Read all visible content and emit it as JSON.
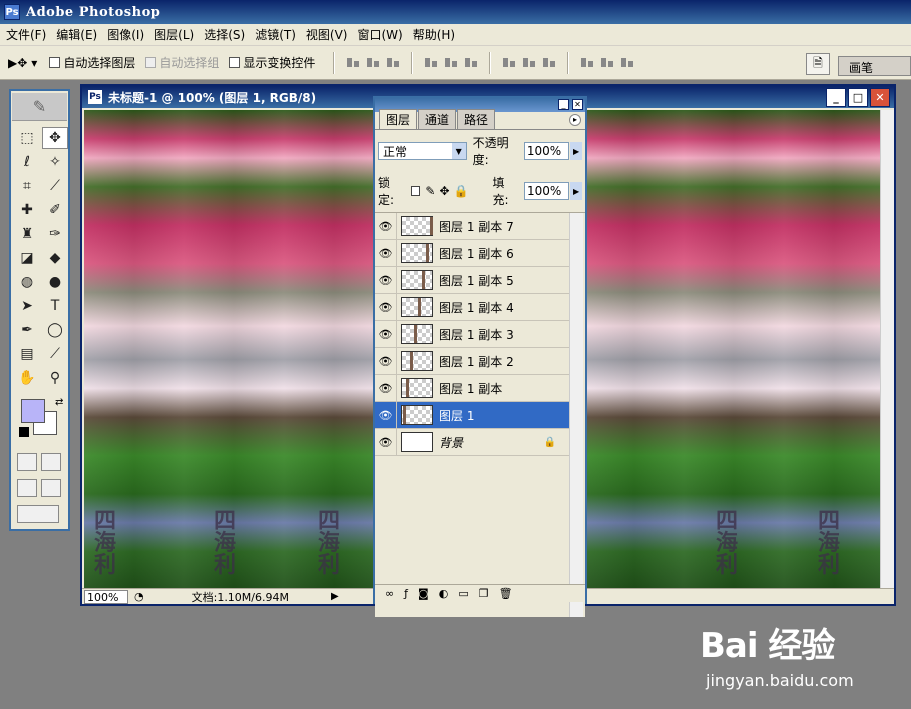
{
  "app": {
    "title": "Adobe Photoshop"
  },
  "menubar": [
    "文件(F)",
    "编辑(E)",
    "图像(I)",
    "图层(L)",
    "选择(S)",
    "滤镜(T)",
    "视图(V)",
    "窗口(W)",
    "帮助(H)"
  ],
  "options": {
    "auto_select_layer": "自动选择图层",
    "auto_select_group": "自动选择组",
    "show_transform": "显示变换控件"
  },
  "brush_tab": "画笔",
  "document": {
    "title": "未标题-1 @ 100% (图层 1, RGB/8)",
    "zoom": "100%",
    "doc_info": "文档:1.10M/6.94M",
    "watermark_chars": [
      "四",
      "海",
      "利"
    ]
  },
  "colors": {
    "foreground": "#b8b4f8",
    "background": "#ffffff"
  },
  "layers_panel": {
    "tabs": [
      "图层",
      "通道",
      "路径"
    ],
    "blend_mode": "正常",
    "opacity_label": "不透明度:",
    "opacity": "100%",
    "lock_label": "锁定:",
    "fill_label": "填充:",
    "fill": "100%",
    "layers": [
      {
        "name": "图层 1 副本 7"
      },
      {
        "name": "图层 1 副本 6"
      },
      {
        "name": "图层 1 副本 5"
      },
      {
        "name": "图层 1 副本 4"
      },
      {
        "name": "图层 1 副本 3"
      },
      {
        "name": "图层 1 副本 2"
      },
      {
        "name": "图层 1 副本"
      },
      {
        "name": "图层 1"
      },
      {
        "name": "背景"
      }
    ]
  },
  "watermark": {
    "logo": "Bai 经验",
    "url": "jingyan.baidu.com"
  }
}
